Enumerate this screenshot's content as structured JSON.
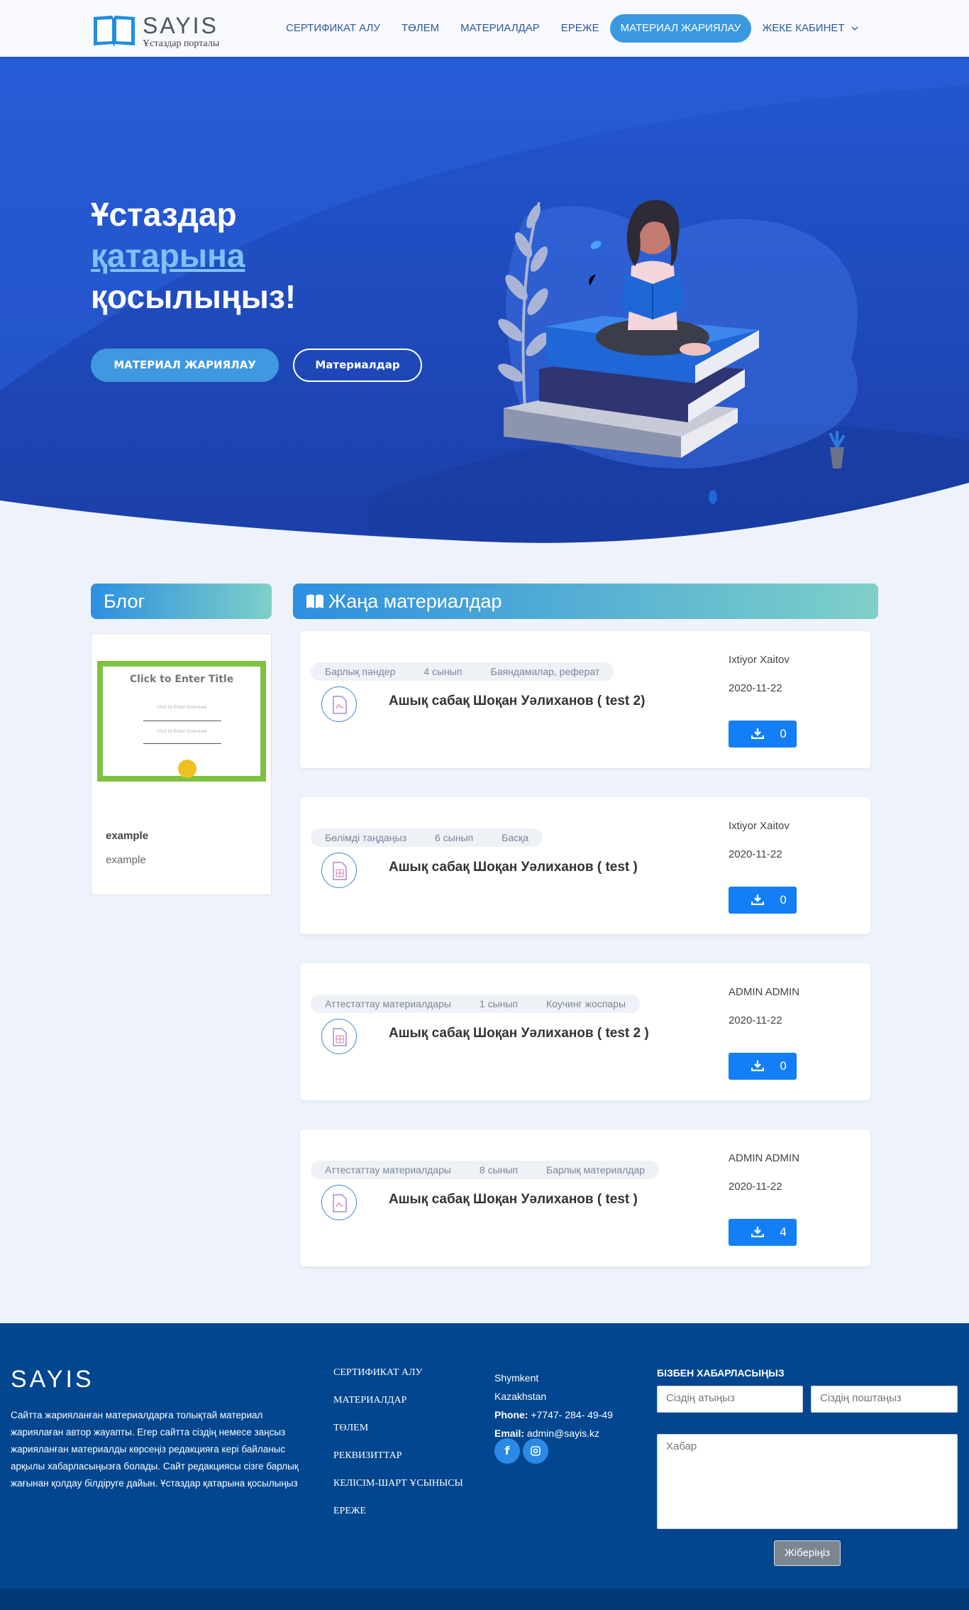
{
  "brand": {
    "title": "SAYIS",
    "subtitle": "Ұстаздар порталы"
  },
  "nav": {
    "items": [
      "СЕРТИФИКАТ АЛУ",
      "ТӨЛЕМ",
      "МАТЕРИАЛДАР",
      "ЕРЕЖЕ",
      "МАТЕРИАЛ ЖАРИЯЛАУ",
      "ЖЕКЕ КАБИНЕТ"
    ],
    "active_index": 4
  },
  "hero": {
    "line1": "Ұстаздар",
    "line2": "қатарына",
    "line3": "қосылыңыз!",
    "primary_button": "МАТЕРИАЛ ЖАРИЯЛАУ",
    "secondary_button": "Материалдар"
  },
  "blog": {
    "heading": "Блог",
    "certificate": {
      "title": "Click to Enter Title",
      "sub1": "Click to Enter Overview",
      "sub2": "Click to Enter Overview"
    },
    "post_title": "example",
    "post_text": "example"
  },
  "materials": {
    "heading": "Жаңа материалдар",
    "items": [
      {
        "tags": [
          "Барлық пәндер",
          "4 сынып",
          "Баяндамалар, реферат"
        ],
        "title": "Ашық сабақ Шоқан Уәлиханов ( test 2)",
        "author": "Ixtiyor Xaitov",
        "date": "2020-11-22",
        "downloads": "0",
        "file_icon": "pdf-file-icon"
      },
      {
        "tags": [
          "Бөлімді таңдаңыз",
          "6 сынып",
          "Басқа"
        ],
        "title": "Ашық сабақ Шоқан Уәлиханов ( test )",
        "author": "Ixtiyor Xaitov",
        "date": "2020-11-22",
        "downloads": "0",
        "file_icon": "excel-file-icon"
      },
      {
        "tags": [
          "Аттестаттау материалдары",
          "1 сынып",
          "Коучинг жоспары"
        ],
        "title": "Ашық сабақ Шоқан Уәлиханов ( test 2 )",
        "author": "ADMIN ADMIN",
        "date": "2020-11-22",
        "downloads": "0",
        "file_icon": "excel-file-icon"
      },
      {
        "tags": [
          "Аттестаттау материалдары",
          "8 сынып",
          "Барлық материалдар"
        ],
        "title": "Ашық сабақ Шоқан Уәлиханов ( test )",
        "author": "ADMIN ADMIN",
        "date": "2020-11-22",
        "downloads": "4",
        "file_icon": "pdf-file-icon"
      }
    ]
  },
  "footer": {
    "logo": "SAYIS",
    "about": "Сайтта жарияланған материалдарға толықтай материал жариялаған автор жауапты. Егер сайтта сіздің немесе заңсыз жарияланған материалды көрсеңіз редакцияға кері байланыс арқылы хабарласыңызға болады. Сайт редакциясы сізге барлық жағынан қолдау білдіруге дайын. Ұстаздар қатарына қосылыңыз",
    "links": [
      "СЕРТИФИКАТ АЛУ",
      "МАТЕРИАЛДАР",
      "ТӨЛЕМ",
      "РЕКВИЗИТТАР",
      "КЕЛІСІМ-ШАРТ ҰСЫНЫСЫ",
      "ЕРЕЖЕ"
    ],
    "city": "Shymkent",
    "country": "Kazakhstan",
    "phone_label": "Phone:",
    "phone": "+7747- 284- 49-49",
    "email_label": "Email:",
    "email": "admin@sayis.kz",
    "contact_heading": "БІЗБЕН ХАБАРЛАСЫҢЫЗ",
    "name_placeholder": "Сіздің атыңыз",
    "email_placeholder": "Сіздің поштаңыз",
    "message_placeholder": "Хабар",
    "send_button": "Жіберіңіз"
  },
  "colors": {
    "accent": "#3a98e0",
    "hero": "#1f4fc9",
    "footer": "#01468f",
    "download": "#137ef5"
  }
}
